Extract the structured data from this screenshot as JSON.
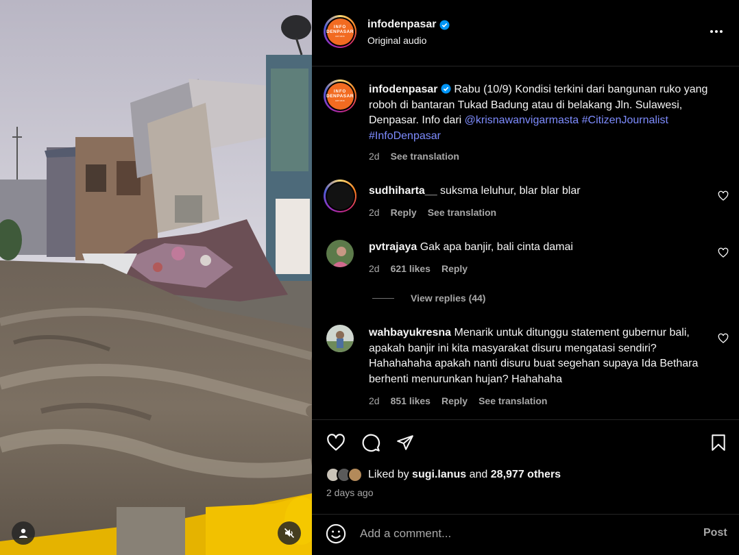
{
  "post": {
    "username": "infodenpasar",
    "audio": "Original audio",
    "logo": {
      "line1": "INFO",
      "line2": "DENPASAR",
      "line3": "EST 2015"
    }
  },
  "caption": {
    "username": "infodenpasar",
    "text": "Rabu (10/9) Kondisi terkini dari bangunan ruko yang roboh di bantaran Tukad Badung atau di belakang Jln. Sulawesi, Denpasar. Info dari",
    "mention": "@krisnawanvigarmasta",
    "hashtags": "#CitizenJournalist #InfoDenpasar",
    "time": "2d",
    "see_translation": "See translation"
  },
  "comments": [
    {
      "username": "sudhiharta__",
      "text": "suksma leluhur, blar blar blar",
      "time": "2d",
      "likes": "",
      "reply": "Reply",
      "see_translation": "See translation"
    },
    {
      "username": "pvtrajaya",
      "text": "Gak apa banjir, bali cinta damai",
      "time": "2d",
      "likes": "621 likes",
      "reply": "Reply",
      "see_translation": ""
    },
    {
      "username": "wahbayukresna",
      "text": "Menarik untuk ditunggu statement gubernur bali, apakah banjir ini kita masyarakat disuru mengatasi sendiri? Hahahahaha apakah nanti disuru buat segehan supaya Ida Bethara berhenti menurunkan hujan? Hahahaha",
      "time": "2d",
      "likes": "851 likes",
      "reply": "Reply",
      "see_translation": "See translation"
    }
  ],
  "view_replies": "View replies (44)",
  "liked_by": {
    "prefix": "Liked by",
    "user": "sugi.lanus",
    "and": "and",
    "others": "28,977 others"
  },
  "time_ago": "2 days ago",
  "add_comment": {
    "placeholder": "Add a comment...",
    "post": "Post"
  },
  "colors": {
    "link": "#7e8cff",
    "logo": "#f26b21",
    "secondary": "#a8a8a8"
  },
  "icons": [
    "verified-badge-icon",
    "more-icon",
    "heart-icon",
    "comment-icon",
    "share-icon",
    "bookmark-icon",
    "emoji-icon",
    "user-icon",
    "muted-speaker-icon"
  ]
}
